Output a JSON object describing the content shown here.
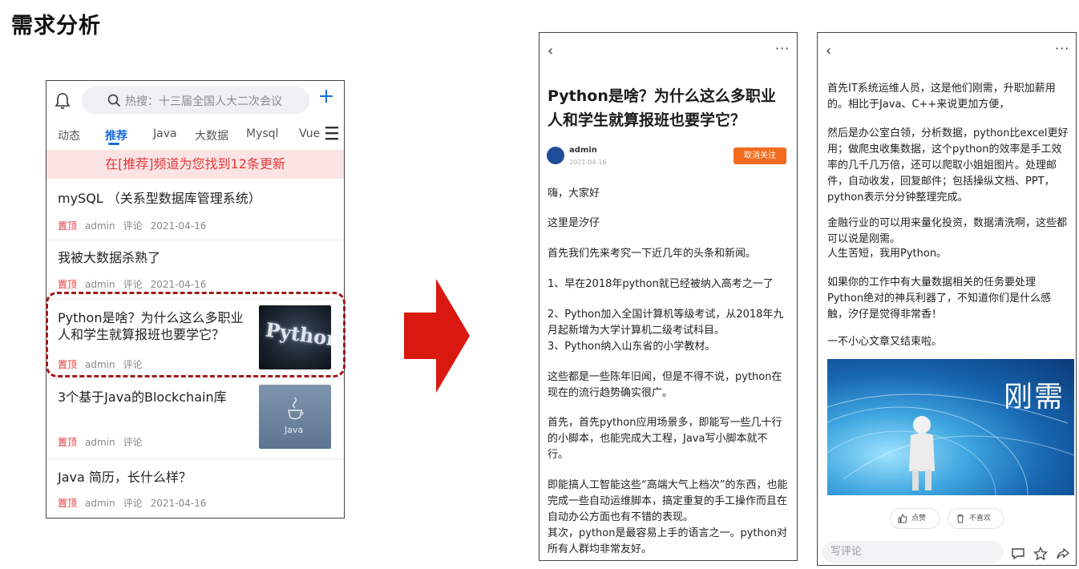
{
  "page_title": "需求分析",
  "phone1": {
    "search_placeholder": "热搜：十三届全国人大二次会议",
    "tabs": [
      "动态",
      "推荐",
      "Java",
      "大数据",
      "Mysql",
      "Vue"
    ],
    "banner": "在[推荐]频道为您找到12条更新",
    "articles": [
      {
        "title": "mySQL （关系型数据库管理系统）",
        "tag": "置顶",
        "author": "admin",
        "comment": "评论",
        "date": "2021-04-16"
      },
      {
        "title": "我被大数据杀熟了",
        "tag": "置顶",
        "author": "admin",
        "comment": "评论",
        "date": "2021-04-16"
      },
      {
        "title": "Python是啥？为什么这么多职业人和学生就算报班也要学它？",
        "tag": "置顶",
        "author": "admin",
        "comment": "评论",
        "thumb_text": "Python"
      },
      {
        "title": "3个基于Java的Blockchain库",
        "tag": "置顶",
        "author": "admin",
        "comment": "评论",
        "thumb_text": "Java"
      },
      {
        "title": "Java 简历，长什么样？",
        "tag": "置顶",
        "author": "admin",
        "comment": "评论",
        "date": "2021-04-16"
      }
    ]
  },
  "phone2": {
    "back": "‹",
    "more": "···",
    "title": "Python是啥？为什么这么多职业人和学生就算报班也要学它？",
    "author": "admin",
    "date": "2021-04-16",
    "follow": "取消关注",
    "paragraphs": [
      "嗨，大家好",
      "这里是汐仔",
      "首先我们先来考究一下近几年的头条和新闻。",
      "1、早在2018年python就已经被纳入高考之一了",
      "2、Python加入全国计算机等级考试，从2018年九月起新增为大学计算机二级考试科目。",
      "3、Python纳入山东省的小学教材。",
      "这些都是一些陈年旧闻，但是不得不说，python在现在的流行趋势确实很广。",
      "首先，首先python应用场景多，即能写一些几十行的小脚本，也能完成大工程，Java写小脚本就不行。",
      "即能搞人工智能这些“高端大气上档次”的东西，也能完成一些自动运维脚本，搞定重复的手工操作而且在自动办公方面也有不错的表现。",
      "其次，python是最容易上手的语言之一。python对所有人群均非常友好。"
    ]
  },
  "phone3": {
    "back": "‹",
    "more": "···",
    "paragraphs": [
      "首先IT系统运维人员，这是他们刚需，升职加薪用的。相比于Java、C++来说更加方便，",
      "然后是办公室白领，分析数据，python比excel更好用；做爬虫收集数据，这个python的效率是手工效率的几千几万倍，还可以爬取小姐姐图片。处理邮件，自动收发，回复邮件；包括操纵文档、PPT，python表示分分钟整理完成。",
      "金融行业的可以用来量化投资，数据清洗啊，这些都可以说是刚需。",
      "人生苦短，我用Python。",
      "如果你的工作中有大量数据相关的任务要处理Python绝对的神兵利器了，不知道你们是什么感触，汐仔是觉得非常香！",
      "一不小心文章又结束啦。"
    ],
    "image_text": "刚需",
    "like": "点赞",
    "dislike": "不喜欢",
    "comment_placeholder": "写评论"
  },
  "colors": {
    "accent_blue": "#1a6fe0",
    "red": "#e4393c",
    "arrow_red": "#d9180f",
    "follow_orange": "#f26b1d",
    "banner_bg": "#fce4e4"
  }
}
